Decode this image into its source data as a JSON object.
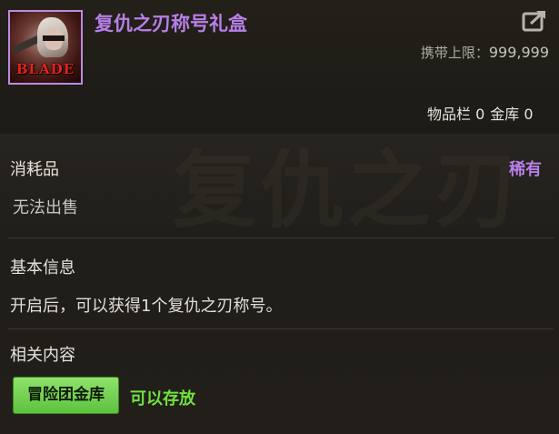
{
  "item": {
    "title": "复仇之刃称号礼盒",
    "icon_text": "BLADE",
    "carry_label": "携带上限：",
    "carry_value": "999,999",
    "storage_inventory": "物品栏 0",
    "storage_bank": "金库 0"
  },
  "consumable": {
    "label": "消耗品",
    "rarity": "稀有",
    "sell_status": "无法出售"
  },
  "basic_info": {
    "label": "基本信息",
    "description": "开启后，可以获得1个复仇之刃称号。"
  },
  "related": {
    "label": "相关内容",
    "badge": "冒险团金库",
    "status": "可以存放"
  },
  "colors": {
    "title_purple": "#b77fe8",
    "storable_green": "#6fe23d",
    "badge_green": "#6fd14b"
  },
  "icons": {
    "share": "share-arrow-icon"
  }
}
